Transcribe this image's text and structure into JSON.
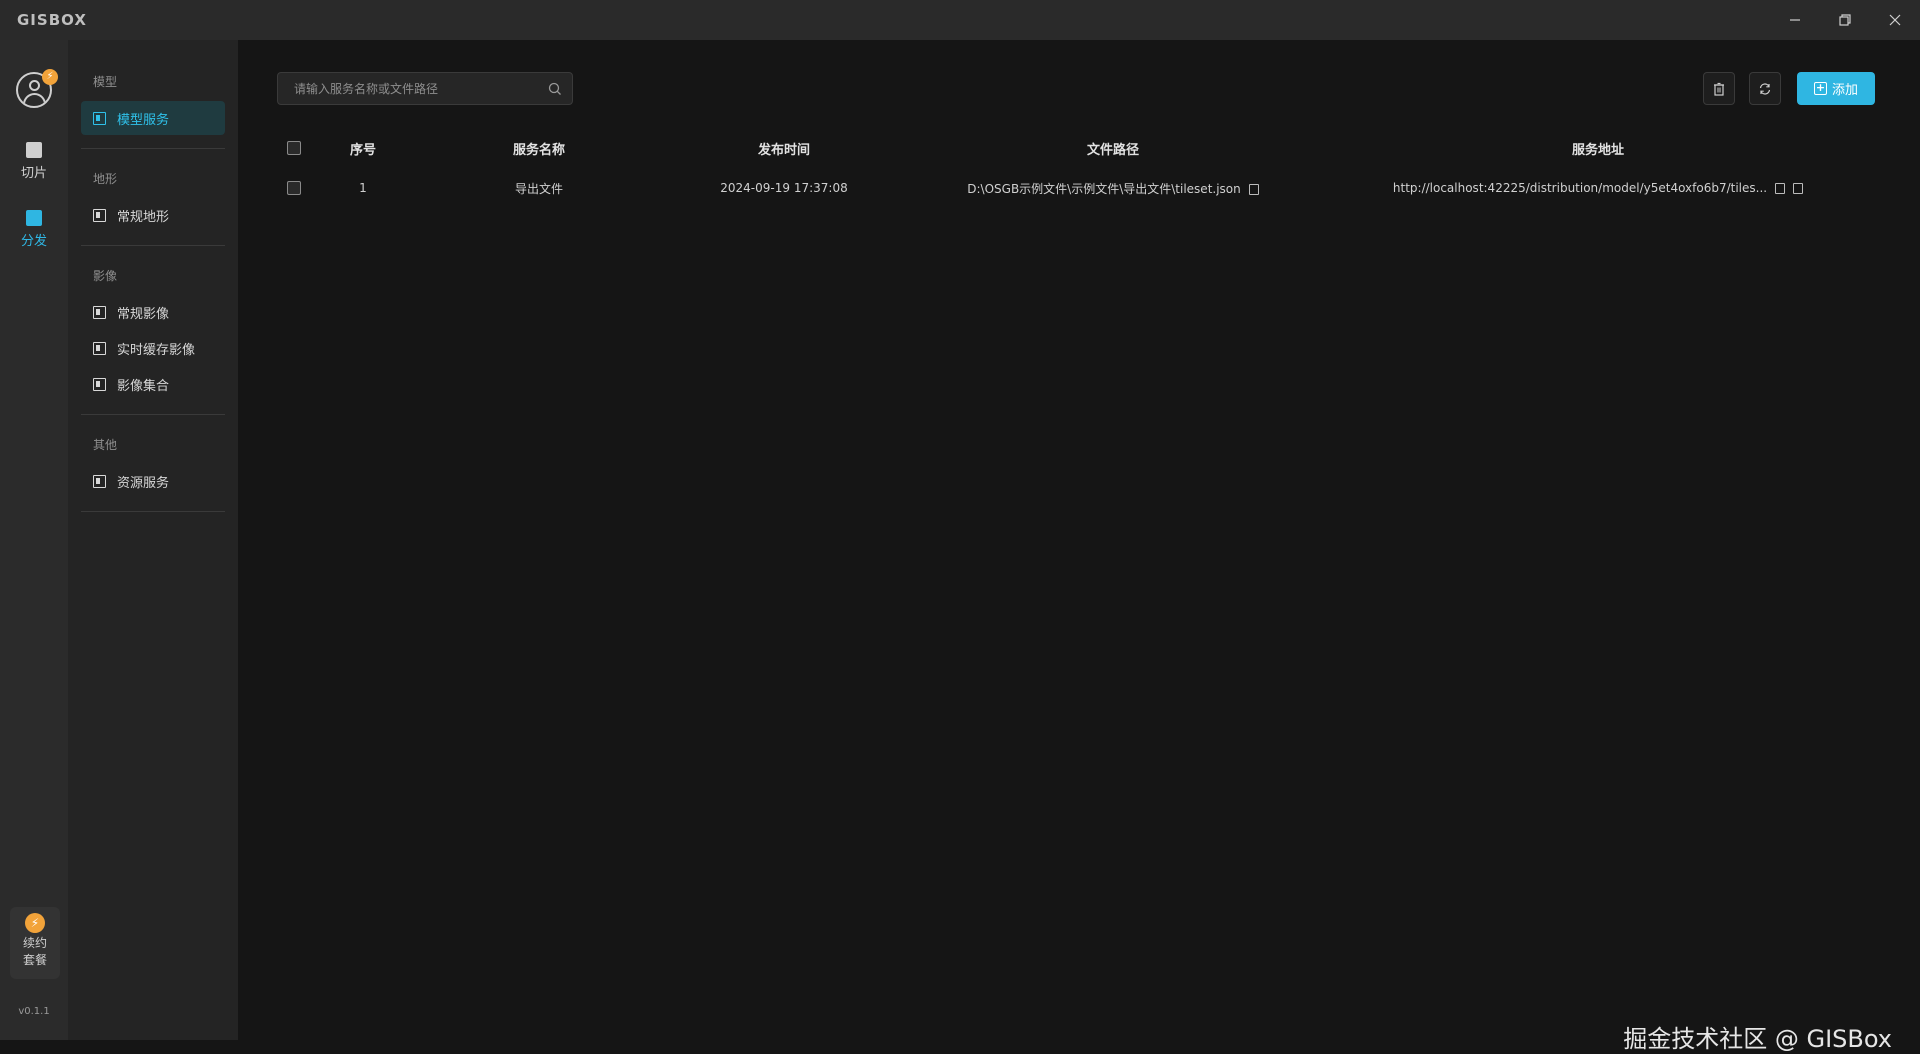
{
  "app": {
    "logo": "GISBOX",
    "version": "v0.1.1"
  },
  "window_controls": {
    "minimize_icon": "minimize-icon",
    "restore_icon": "restore-icon",
    "close_icon": "close-icon"
  },
  "rail": {
    "avatar_badge": "⚡",
    "items": [
      {
        "label": "切片",
        "icon": "tile-icon"
      },
      {
        "label": "分发",
        "icon": "distribute-icon"
      }
    ],
    "renew": {
      "line1": "续约",
      "line2": "套餐"
    }
  },
  "subnav": {
    "groups": [
      {
        "title": "模型",
        "items": [
          {
            "label": "模型服务"
          }
        ]
      },
      {
        "title": "地形",
        "items": [
          {
            "label": "常规地形"
          }
        ]
      },
      {
        "title": "影像",
        "items": [
          {
            "label": "常规影像"
          },
          {
            "label": "实时缓存影像"
          },
          {
            "label": "影像集合"
          }
        ]
      },
      {
        "title": "其他",
        "items": [
          {
            "label": "资源服务"
          }
        ]
      }
    ]
  },
  "toolbar": {
    "search_placeholder": "请输入服务名称或文件路径",
    "add_label": "添加"
  },
  "table": {
    "headers": [
      "序号",
      "服务名称",
      "发布时间",
      "文件路径",
      "服务地址"
    ],
    "rows": [
      {
        "index": "1",
        "name": "导出文件",
        "time": "2024-09-19 17:37:08",
        "path": "D:\\OSGB示例文件\\示例文件\\导出文件\\tileset.json",
        "url": "http://localhost:42225/distribution/model/y5et4oxfo6b7/tiles..."
      }
    ]
  },
  "watermark": "掘金技术社区 @ GISBox",
  "colors": {
    "accent": "#2fb6e2",
    "badge": "#f2a33a"
  }
}
